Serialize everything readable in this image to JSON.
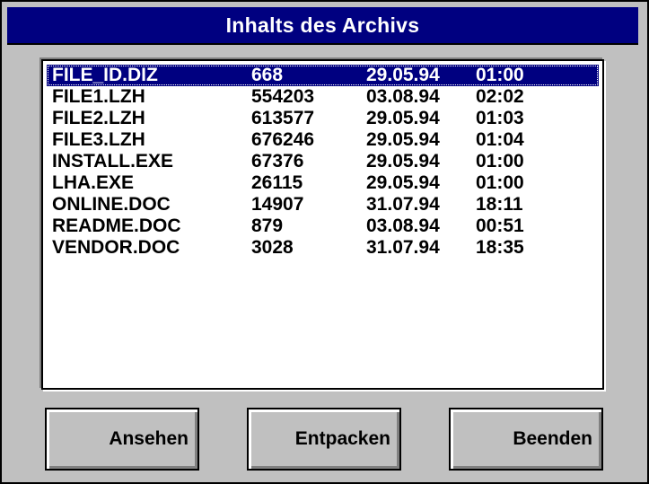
{
  "window": {
    "title": "Inhalts des Archivs"
  },
  "list": {
    "columns": [
      "name",
      "size",
      "date",
      "time"
    ],
    "rows": [
      {
        "name": "FILE_ID.DIZ",
        "size": "668",
        "date": "29.05.94",
        "time": "01:00",
        "selected": true
      },
      {
        "name": "FILE1.LZH",
        "size": "554203",
        "date": "03.08.94",
        "time": "02:02"
      },
      {
        "name": "FILE2.LZH",
        "size": "613577",
        "date": "29.05.94",
        "time": "01:03"
      },
      {
        "name": "FILE3.LZH",
        "size": "676246",
        "date": "29.05.94",
        "time": "01:04"
      },
      {
        "name": "INSTALL.EXE",
        "size": "67376",
        "date": "29.05.94",
        "time": "01:00"
      },
      {
        "name": "LHA.EXE",
        "size": "26115",
        "date": "29.05.94",
        "time": "01:00"
      },
      {
        "name": "ONLINE.DOC",
        "size": "14907",
        "date": "31.07.94",
        "time": "18:11"
      },
      {
        "name": "README.DOC",
        "size": "879",
        "date": "03.08.94",
        "time": "00:51"
      },
      {
        "name": "VENDOR.DOC",
        "size": "3028",
        "date": "31.07.94",
        "time": "18:35"
      }
    ]
  },
  "buttons": {
    "view_label": "Ansehen",
    "extract_label": "Entpacken",
    "exit_label": "Beenden"
  },
  "colors": {
    "titlebar": "#000080",
    "window_face": "#c0c0c0",
    "selection": "#000080"
  }
}
